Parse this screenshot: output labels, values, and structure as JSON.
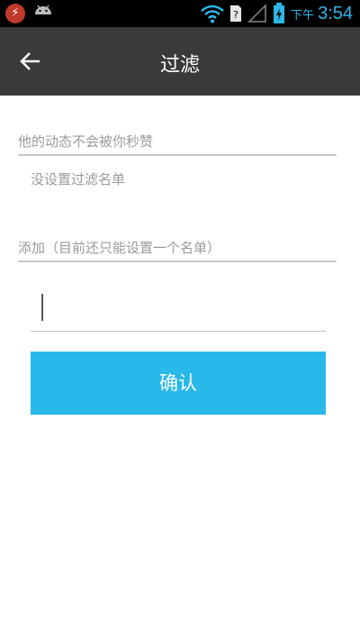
{
  "status_bar": {
    "ampm": "下午",
    "time": "3:54",
    "accent_color": "#2fb6e8",
    "icons": [
      "app-notification-icon",
      "android-icon",
      "wifi-icon",
      "sim-icon",
      "signal-icon",
      "battery-icon"
    ]
  },
  "title_bar": {
    "title": "过滤",
    "back_icon": "arrow-left-icon"
  },
  "sections": {
    "liked_header": "他的动态不会被你秒赞",
    "empty_hint": "没设置过滤名单",
    "add_header": "添加（目前还只能设置一个名单）"
  },
  "input": {
    "value": "",
    "placeholder": ""
  },
  "confirm_button": {
    "label": "确认",
    "color": "#29b8ea"
  }
}
